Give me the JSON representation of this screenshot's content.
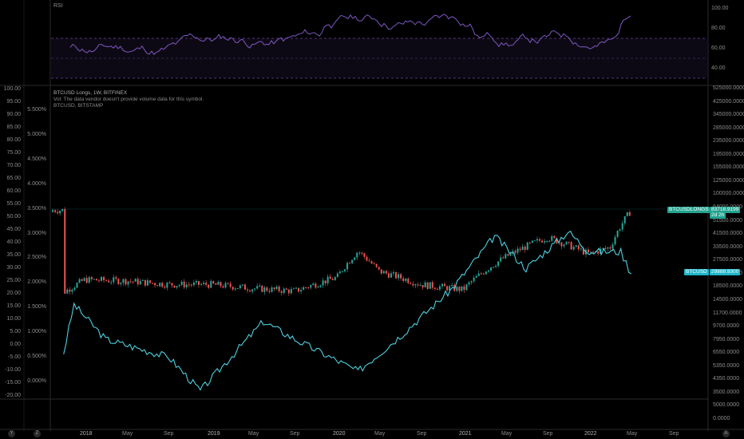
{
  "rsi": {
    "name": "RSI",
    "scale_labels": [
      "100.00",
      "80.00",
      "60.00",
      "40.00"
    ],
    "line_color": "#7e57c2"
  },
  "legend": {
    "title": "BTCUSD Longs, 1W, BITFINEX",
    "vol_note": "Vol: The data vendor doesn't provide volume data for this symbol.",
    "overlay": "BTCUSD, BITSTAMP"
  },
  "left_scale": {
    "outer": [
      "100.00",
      "95.00",
      "90.00",
      "85.00",
      "80.00",
      "75.00",
      "70.00",
      "65.00",
      "60.00",
      "55.00",
      "50.00",
      "45.00",
      "40.00",
      "35.00",
      "30.00",
      "25.00",
      "20.00",
      "15.00",
      "10.00",
      "5.00",
      "0.00",
      "-5.00",
      "-10.00",
      "-15.00",
      "-20.00"
    ],
    "inner": [
      "5.500%",
      "5.000%",
      "4.500%",
      "4.000%",
      "3.500%",
      "3.000%",
      "2.500%",
      "2.000%",
      "1.500%",
      "1.000%",
      "0.500%",
      "0.000%"
    ]
  },
  "right_scale": [
    "525000.0000",
    "425000.0000",
    "345000.0000",
    "285000.0000",
    "235000.0000",
    "195000.0000",
    "155000.0000",
    "125000.0000",
    "100000.0000",
    "64000.0000",
    "51500.0000",
    "41500.0000",
    "33500.0000",
    "27500.0000",
    "22500.0000",
    "18500.0000",
    "14500.0000",
    "11700.0000",
    "9700.0000",
    "7950.0000",
    "6550.0000",
    "5350.0000",
    "4350.0000",
    "3500.0000",
    "5000.0000",
    "0.0000"
  ],
  "tags": {
    "longs_name": "BTCUSDLONGS",
    "longs_value": "83718.9199",
    "longs_countdown": "2d 2h",
    "btc_name": "BTCUSD",
    "btc_value": "29888.9300"
  },
  "time_axis": [
    "2018",
    "May",
    "Sep",
    "2019",
    "May",
    "Sep",
    "2020",
    "May",
    "Sep",
    "2021",
    "May",
    "Sep",
    "2022",
    "May",
    "Sep"
  ],
  "bottom_buttons": {
    "left1": "Y",
    "left2": "Z",
    "right": "A"
  },
  "colors": {
    "up": "#26a69a",
    "down": "#ef5350",
    "btc_line": "#4dd0e1",
    "rsi_band": "#7e57c2"
  },
  "chart_data": {
    "type": "line",
    "series": [
      {
        "name": "BTCUSD Longs",
        "x": [
          "2017-11",
          "2018-01",
          "2018-05",
          "2018-09",
          "2019-01",
          "2019-05",
          "2019-09",
          "2020-01",
          "2020-03",
          "2020-05",
          "2020-09",
          "2021-01",
          "2021-05",
          "2021-09",
          "2022-01",
          "2022-03",
          "2022-05"
        ],
        "values": [
          21000,
          26000,
          25500,
          24000,
          24000,
          22500,
          21500,
          27000,
          42000,
          30000,
          24000,
          22000,
          38000,
          53000,
          40000,
          45000,
          83718.9199
        ]
      },
      {
        "name": "BTCUSD",
        "x": [
          "2017-11",
          "2017-12",
          "2018-03",
          "2018-09",
          "2018-12",
          "2019-06",
          "2019-09",
          "2020-03",
          "2020-07",
          "2020-12",
          "2021-04",
          "2021-07",
          "2021-11",
          "2022-01",
          "2022-04",
          "2022-05"
        ],
        "values": [
          7000,
          17000,
          9000,
          6500,
          3500,
          12500,
          9000,
          5000,
          9500,
          23000,
          60000,
          33000,
          65000,
          45000,
          45000,
          29888.93
        ]
      }
    ]
  }
}
